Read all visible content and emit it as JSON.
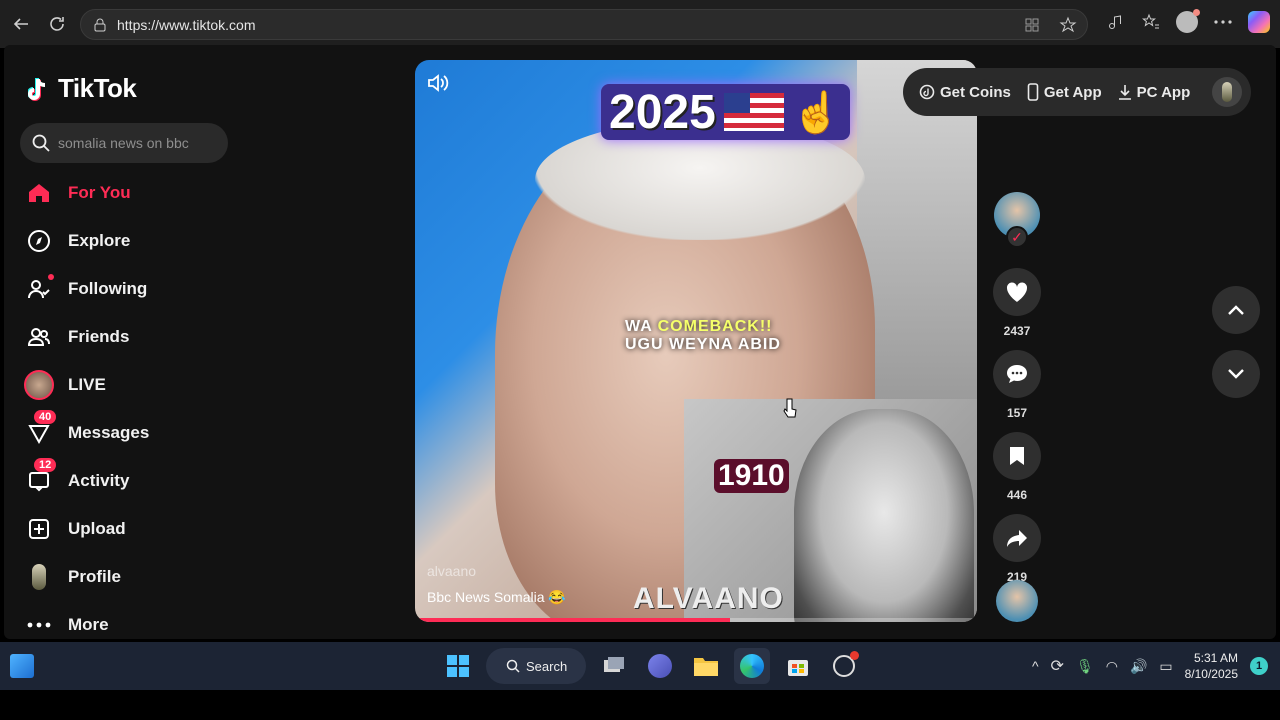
{
  "browser": {
    "url": "https://www.tiktok.com"
  },
  "sidebar": {
    "logo_text": "TikTok",
    "search_placeholder": "somalia news on bbc",
    "items": [
      {
        "label": "For You",
        "icon": "home-icon",
        "active": true
      },
      {
        "label": "Explore",
        "icon": "compass-icon"
      },
      {
        "label": "Following",
        "icon": "following-icon"
      },
      {
        "label": "Friends",
        "icon": "friends-icon"
      },
      {
        "label": "LIVE",
        "icon": "live-avatar-icon"
      },
      {
        "label": "Messages",
        "icon": "messages-icon",
        "badge": "40"
      },
      {
        "label": "Activity",
        "icon": "activity-icon",
        "badge": "12"
      },
      {
        "label": "Upload",
        "icon": "upload-icon"
      },
      {
        "label": "Profile",
        "icon": "profile-avatar-icon"
      },
      {
        "label": "More",
        "icon": "more-icon"
      }
    ]
  },
  "top_actions": {
    "get_coins": "Get Coins",
    "get_app": "Get App",
    "pc_app": "PC App"
  },
  "video": {
    "overlay_year_top": "2025",
    "overlay_line1_a": "WA ",
    "overlay_line1_b": "COMEBACK!!",
    "overlay_line2": "UGU WEYNA ABID",
    "overlay_year_inset": "1910",
    "watermark": "ALVAANO",
    "author": "alvaano",
    "description": "Bbc News Somalia 😂",
    "progress": 0.56
  },
  "actions": {
    "likes": "2437",
    "comments": "157",
    "saves": "446",
    "shares": "219"
  },
  "taskbar": {
    "search_label": "Search",
    "time": "5:31 AM",
    "date": "8/10/2025",
    "notification_count": "1"
  },
  "colors": {
    "accent": "#fe2c55",
    "page_bg": "#121212"
  }
}
